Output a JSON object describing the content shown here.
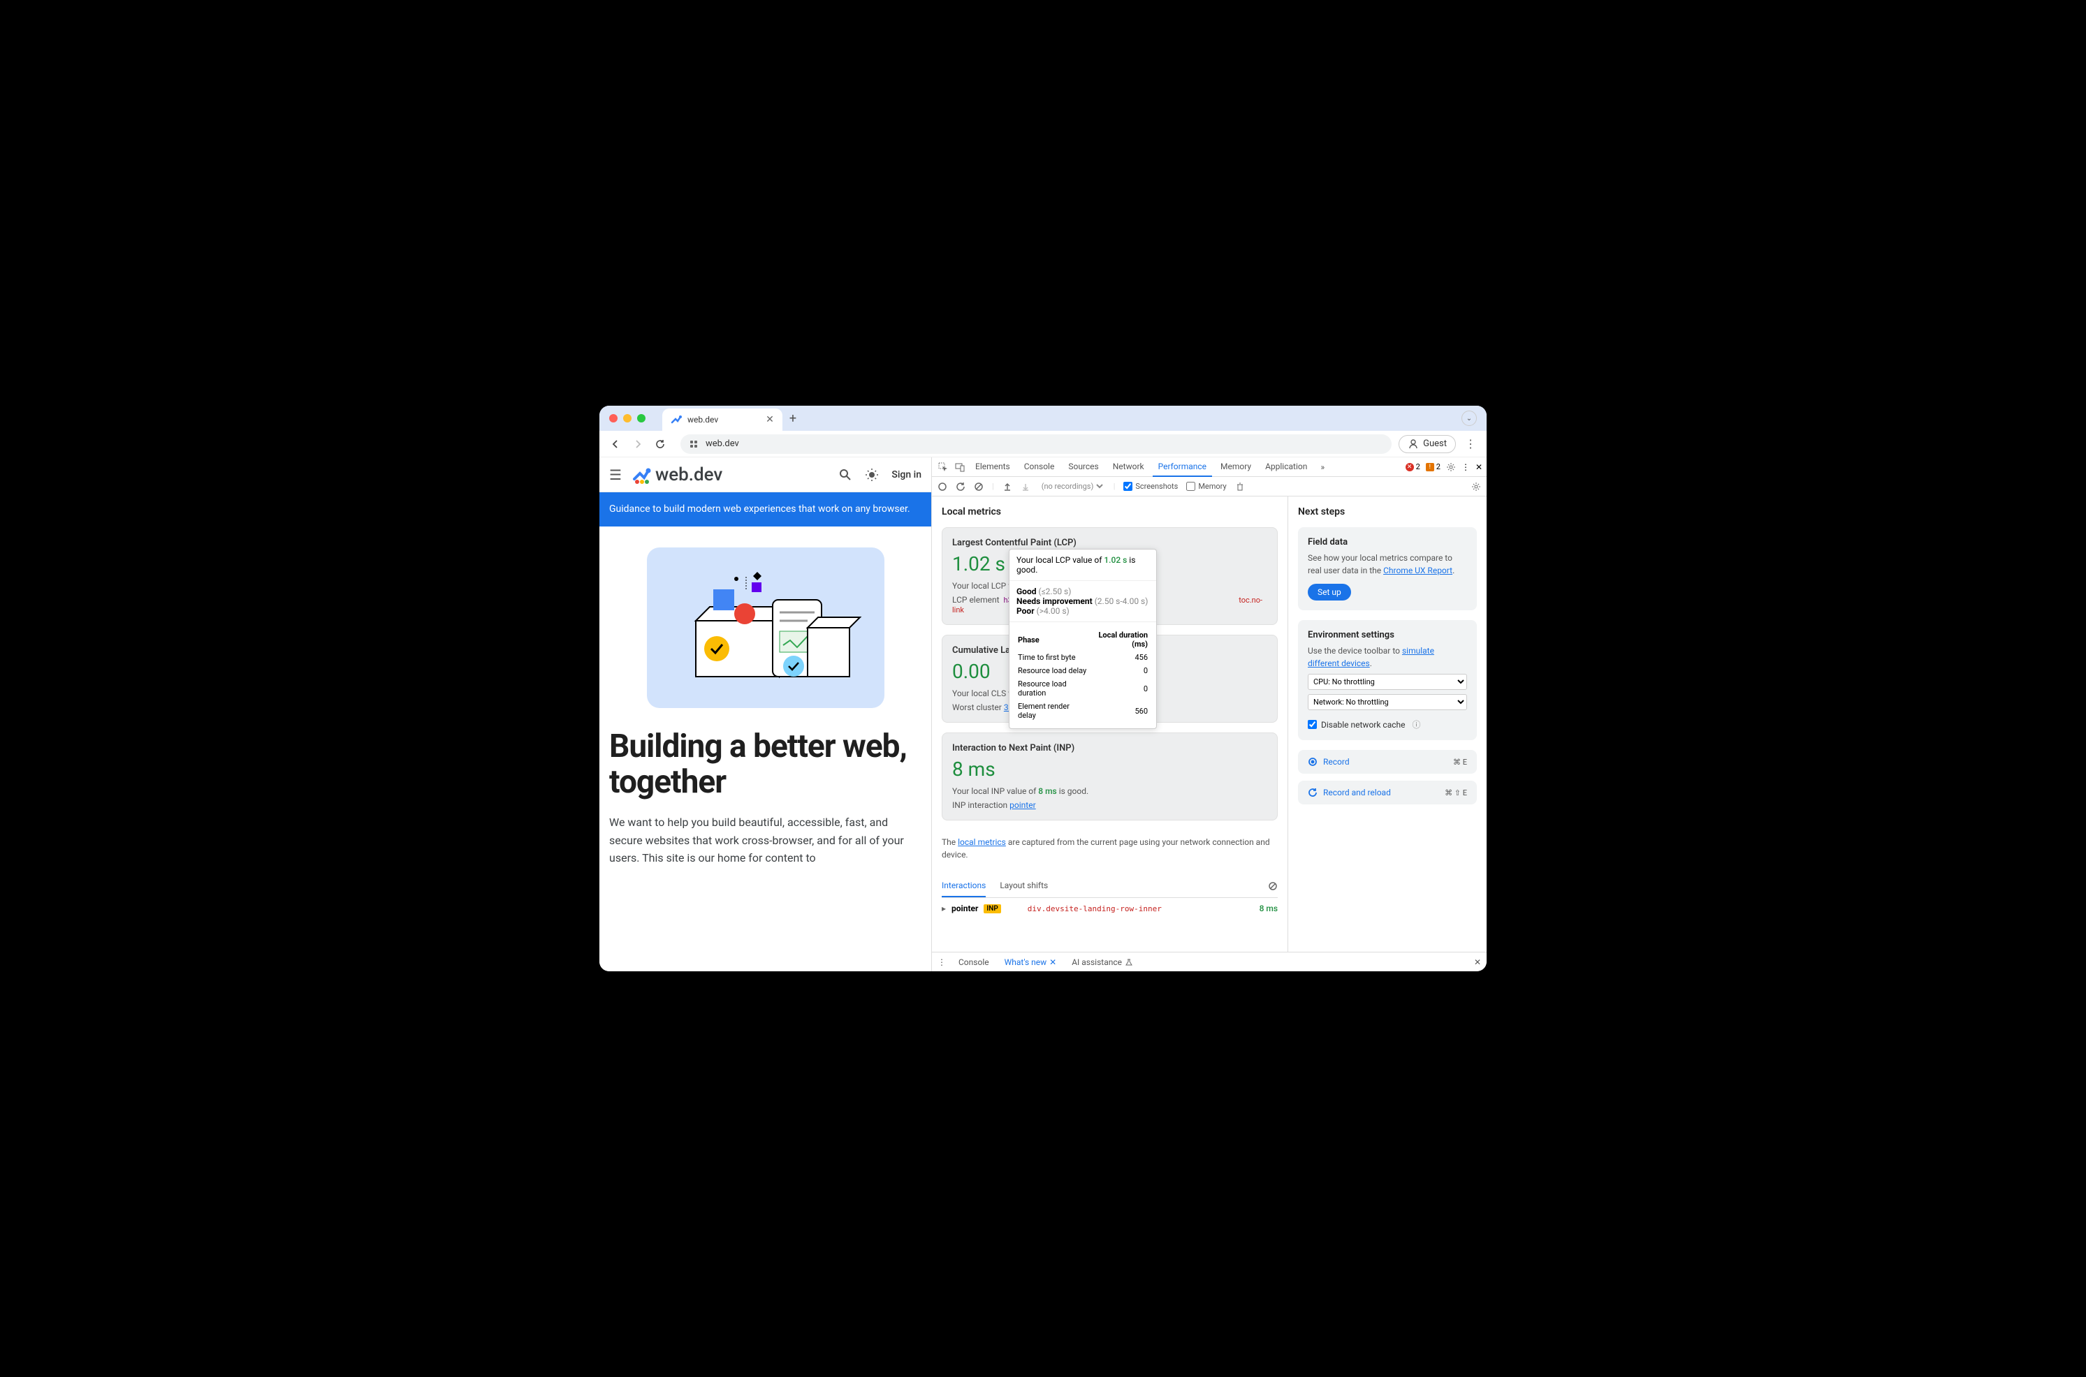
{
  "browser": {
    "tab_title": "web.dev",
    "url": "web.dev",
    "guest_label": "Guest"
  },
  "page": {
    "logo_text": "web.dev",
    "signin": "Sign in",
    "banner": "Guidance to build modern web experiences that work on any browser.",
    "hero_title": "Building a better web, together",
    "hero_desc": "We want to help you build beautiful, accessible, fast, and secure websites that work cross-browser, and for all of your users. This site is our home for content to"
  },
  "devtools": {
    "tabs": [
      "Elements",
      "Console",
      "Sources",
      "Network",
      "Performance",
      "Memory",
      "Application"
    ],
    "active_tab": "Performance",
    "errors": "2",
    "warnings": "2",
    "toolbar": {
      "recordings": "(no recordings)",
      "screenshots_label": "Screenshots",
      "memory_label": "Memory"
    },
    "local_metrics_title": "Local metrics",
    "lcp": {
      "title": "Largest Contentful Paint (LCP)",
      "value": "1.02 s",
      "desc_prefix": "Your local LCP valu",
      "element_label": "LCP element",
      "element_tag": "h3",
      "element_cls": "toc.no-link"
    },
    "cls": {
      "title": "Cumulative Layo",
      "value": "0.00",
      "desc_prefix": "Your local CLS valu",
      "cluster_label": "Worst cluster",
      "cluster_link": "3 shifts"
    },
    "inp": {
      "title": "Interaction to Next Paint (INP)",
      "value": "8 ms",
      "desc": "Your local INP value of ",
      "desc_val": "8 ms",
      "desc_suffix": " is good.",
      "interaction_label": "INP interaction",
      "interaction_link": "pointer"
    },
    "tooltip": {
      "line1_prefix": "Your local LCP value of ",
      "line1_val": "1.02 s",
      "line1_suffix": " is good.",
      "good": "Good",
      "good_range": "(≤2.50 s)",
      "needs": "Needs improvement",
      "needs_range": "(2.50 s-4.00 s)",
      "poor": "Poor",
      "poor_range": "(>4.00 s)",
      "phase_header": "Phase",
      "duration_header": "Local duration (ms)",
      "rows": [
        {
          "label": "Time to first byte",
          "val": "456"
        },
        {
          "label": "Resource load delay",
          "val": "0"
        },
        {
          "label": "Resource load duration",
          "val": "0"
        },
        {
          "label": "Element render delay",
          "val": "560"
        }
      ]
    },
    "note_prefix": "The ",
    "note_link": "local metrics",
    "note_suffix": " are captured from the current page using your network connection and device.",
    "bottom_tabs": {
      "interactions": "Interactions",
      "layout_shifts": "Layout shifts"
    },
    "interaction_row": {
      "type": "pointer",
      "badge": "INP",
      "selector": "div.devsite-landing-row-inner",
      "time": "8 ms"
    },
    "sidebar": {
      "title": "Next steps",
      "field_data": {
        "title": "Field data",
        "desc_prefix": "See how your local metrics compare to real user data in the ",
        "link": "Chrome UX Report",
        "button": "Set up"
      },
      "env": {
        "title": "Environment settings",
        "desc_prefix": "Use the device toolbar to ",
        "link": "simulate different devices",
        "cpu": "CPU: No throttling",
        "network": "Network: No throttling",
        "cache_label": "Disable network cache"
      },
      "record": "Record",
      "record_shortcut": "⌘ E",
      "record_reload": "Record and reload",
      "record_reload_shortcut": "⌘ ⇧ E"
    },
    "drawer": {
      "console": "Console",
      "whatsnew": "What's new",
      "ai": "AI assistance"
    }
  }
}
